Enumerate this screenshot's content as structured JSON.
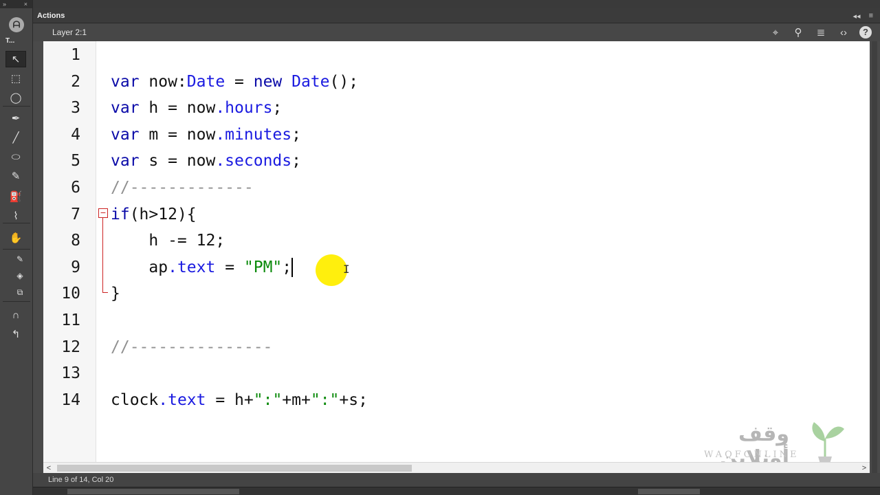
{
  "toolbar": {
    "collapse_glyph": "»",
    "close_glyph": "×",
    "tools_label": "T...",
    "tools": [
      {
        "name": "selection-tool",
        "glyph": "↖"
      },
      {
        "name": "free-transform-tool",
        "glyph": "⬚"
      },
      {
        "name": "lasso-tool",
        "glyph": "◯"
      },
      {
        "name": "pen-tool",
        "glyph": "✒"
      },
      {
        "name": "line-tool",
        "glyph": "╱"
      },
      {
        "name": "oval-tool",
        "glyph": "⬭"
      },
      {
        "name": "pencil-tool",
        "glyph": "✎"
      },
      {
        "name": "paint-bucket-tool",
        "glyph": "⛽"
      },
      {
        "name": "eyedropper-tool",
        "glyph": "⌇"
      },
      {
        "name": "hand-tool",
        "glyph": "✋"
      },
      {
        "name": "stroke-color-tool",
        "glyph": "✎"
      },
      {
        "name": "fill-color-tool",
        "glyph": "◈"
      },
      {
        "name": "swap-colors-tool",
        "glyph": "⧉"
      },
      {
        "name": "snap-magnet-tool",
        "glyph": "∩"
      },
      {
        "name": "smooth-tool",
        "glyph": "↰"
      }
    ]
  },
  "panel": {
    "tab_title": "Actions",
    "controls": [
      "◂◂",
      "≡"
    ],
    "layer_label": "Layer 2:1",
    "icons": [
      "⌖",
      "⚲",
      "≣",
      "‹›",
      "?"
    ]
  },
  "editor": {
    "lines": [
      {
        "num": "1",
        "tokens": []
      },
      {
        "num": "2",
        "tokens": [
          {
            "t": "var ",
            "c": "kw"
          },
          {
            "t": "now:",
            "c": ""
          },
          {
            "t": "Date",
            "c": "prop"
          },
          {
            "t": " = ",
            "c": ""
          },
          {
            "t": "new ",
            "c": "kw"
          },
          {
            "t": "Date",
            "c": "prop"
          },
          {
            "t": "();",
            "c": ""
          }
        ]
      },
      {
        "num": "3",
        "tokens": [
          {
            "t": "var ",
            "c": "kw"
          },
          {
            "t": "h = now",
            "c": ""
          },
          {
            "t": ".hours",
            "c": "prop"
          },
          {
            "t": ";",
            "c": ""
          }
        ]
      },
      {
        "num": "4",
        "tokens": [
          {
            "t": "var ",
            "c": "kw"
          },
          {
            "t": "m = now",
            "c": ""
          },
          {
            "t": ".minutes",
            "c": "prop"
          },
          {
            "t": ";",
            "c": ""
          }
        ]
      },
      {
        "num": "5",
        "tokens": [
          {
            "t": "var ",
            "c": "kw"
          },
          {
            "t": "s = now",
            "c": ""
          },
          {
            "t": ".seconds",
            "c": "prop"
          },
          {
            "t": ";",
            "c": ""
          }
        ]
      },
      {
        "num": "6",
        "tokens": [
          {
            "t": "//-------------",
            "c": "cmt"
          }
        ]
      },
      {
        "num": "7",
        "tokens": [
          {
            "t": "if",
            "c": "kw"
          },
          {
            "t": "(h>12){",
            "c": ""
          }
        ]
      },
      {
        "num": "8",
        "tokens": [
          {
            "t": "    h -= 12;",
            "c": ""
          }
        ]
      },
      {
        "num": "9",
        "tokens": [
          {
            "t": "    ap",
            "c": ""
          },
          {
            "t": ".text",
            "c": "prop"
          },
          {
            "t": " = ",
            "c": ""
          },
          {
            "t": "\"PM\"",
            "c": "str"
          },
          {
            "t": ";",
            "c": ""
          }
        ],
        "cursor": true
      },
      {
        "num": "10",
        "tokens": [
          {
            "t": "}",
            "c": ""
          }
        ]
      },
      {
        "num": "11",
        "tokens": []
      },
      {
        "num": "12",
        "tokens": [
          {
            "t": "//---------------",
            "c": "cmt"
          }
        ]
      },
      {
        "num": "13",
        "tokens": []
      },
      {
        "num": "14",
        "tokens": [
          {
            "t": "clock",
            "c": ""
          },
          {
            "t": ".text",
            "c": "prop"
          },
          {
            "t": " = h+",
            "c": ""
          },
          {
            "t": "\":\"",
            "c": "str"
          },
          {
            "t": "+m+",
            "c": ""
          },
          {
            "t": "\":\"",
            "c": "str"
          },
          {
            "t": "+s;",
            "c": ""
          }
        ]
      }
    ],
    "fold_glyph": "−",
    "ibeam_glyph": "I"
  },
  "watermark": {
    "arabic": "وقف أونلاين",
    "latin": "WAQFONLINE"
  },
  "scroll": {
    "left_arrow": "<",
    "right_arrow": ">"
  },
  "status": {
    "text": "Line 9 of 14, Col 20"
  },
  "colors": {
    "keyword": "#0a0aa8",
    "property": "#1a1ae0",
    "string": "#0b8a0b",
    "comment": "#909090",
    "highlight": "#ffee00"
  }
}
